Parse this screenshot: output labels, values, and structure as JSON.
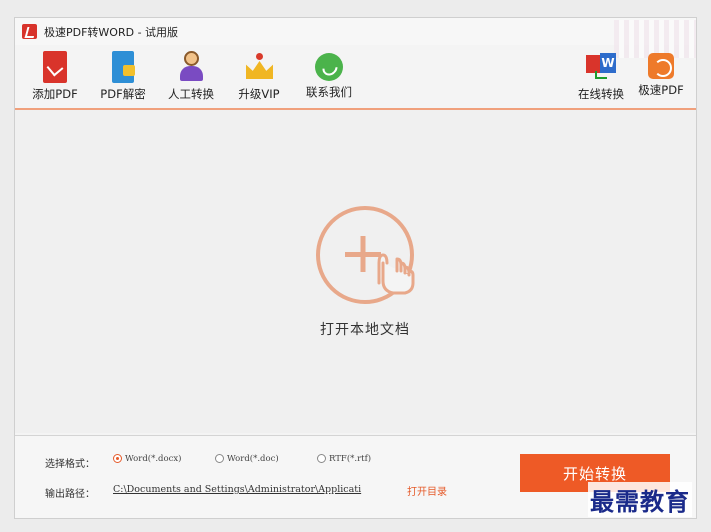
{
  "window": {
    "title": "极速PDF转WORD - 试用版"
  },
  "toolbar": {
    "left": [
      {
        "label": "添加PDF",
        "icon": "add-pdf-icon"
      },
      {
        "label": "PDF解密",
        "icon": "pdf-decrypt-icon"
      },
      {
        "label": "人工转换",
        "icon": "manual-convert-icon"
      },
      {
        "label": "升级VIP",
        "icon": "crown-icon"
      },
      {
        "label": "联系我们",
        "icon": "wechat-icon"
      }
    ],
    "right": [
      {
        "label": "在线转换",
        "icon": "online-convert-icon"
      },
      {
        "label": "极速PDF",
        "icon": "fast-pdf-icon"
      }
    ]
  },
  "main": {
    "open_label": "打开本地文档",
    "open_icon": "plus-hand-icon"
  },
  "options": {
    "format_label": "选择格式：",
    "formats": [
      {
        "label": "Word(*.docx)",
        "selected": true
      },
      {
        "label": "Word(*.doc)",
        "selected": false
      },
      {
        "label": "RTF(*.rtf)",
        "selected": false
      }
    ],
    "path_label": "输出路径：",
    "path_value": "C:\\Documents and Settings\\Administrator\\Applicati",
    "open_dir_label": "打开目录",
    "start_label": "开始转换"
  },
  "watermark": "最需教育",
  "colors": {
    "accent": "#ee5a26",
    "circle": "#e8a88a"
  }
}
